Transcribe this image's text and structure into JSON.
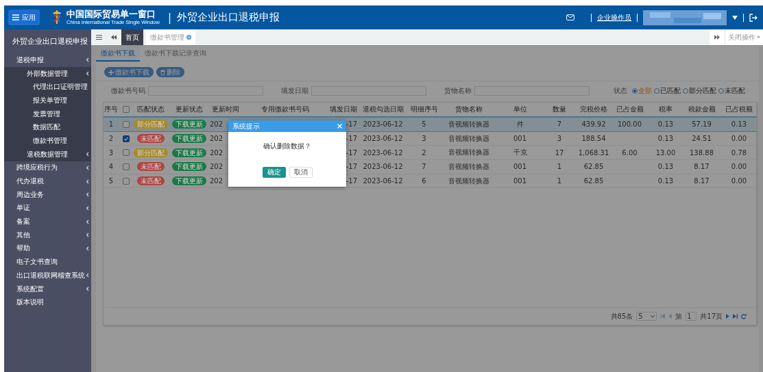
{
  "header": {
    "app_button": "应用",
    "logo_title": "中国国际贸易单一窗口",
    "logo_subtitle": "China International Trade Single Window",
    "separator": "|",
    "system_title": "外贸企业出口退税申报",
    "user_role": "企业操作员"
  },
  "sidebar": {
    "title": "外贸企业出口退税申报",
    "items": [
      {
        "label": "退税申报",
        "collapsible": true,
        "children": [
          {
            "label": "外部数据管理",
            "collapsible": true,
            "children": [
              {
                "label": "代理出口证明管理",
                "collapsible": false
              },
              {
                "label": "报关单管理",
                "collapsible": false
              },
              {
                "label": "发票管理",
                "collapsible": false
              },
              {
                "label": "数据匹配",
                "collapsible": false
              },
              {
                "label": "缴款书管理",
                "collapsible": false
              }
            ]
          },
          {
            "label": "退税数据管理",
            "collapsible": true
          }
        ]
      },
      {
        "label": "跨境应税行为",
        "collapsible": true
      },
      {
        "label": "代办退税",
        "collapsible": true
      },
      {
        "label": "周边业务",
        "collapsible": true
      },
      {
        "label": "单证",
        "collapsible": true
      },
      {
        "label": "备案",
        "collapsible": true
      },
      {
        "label": "其他",
        "collapsible": true
      },
      {
        "label": "帮助",
        "collapsible": true
      },
      {
        "label": "电子文书查询",
        "collapsible": false
      },
      {
        "label": "出口退税联网稽查系统",
        "collapsible": true
      },
      {
        "label": "系统配置",
        "collapsible": true
      },
      {
        "label": "版本说明",
        "collapsible": false
      }
    ]
  },
  "page_tabs": [
    {
      "label": "首页",
      "kind": "home"
    },
    {
      "label": "缴款书管理",
      "kind": "page"
    }
  ],
  "close_menu": "关闭操作",
  "sub_tabs": [
    {
      "label": "缴款书下载",
      "selected": true
    },
    {
      "label": "缴款书下载记录查询",
      "selected": false
    }
  ],
  "toolbar": [
    {
      "label": "缴款书下载",
      "kind": "add"
    },
    {
      "label": "删除",
      "kind": "delete"
    }
  ],
  "search_fields": [
    {
      "label": "缴款书号码"
    },
    {
      "label": "填发日期"
    },
    {
      "label": "货物名称"
    }
  ],
  "status_filter": {
    "label": "状态",
    "options": [
      {
        "label": "全部",
        "selected": true
      },
      {
        "label": "已匹配",
        "selected": false
      },
      {
        "label": "部分匹配",
        "selected": false
      },
      {
        "label": "未匹配",
        "selected": false
      }
    ]
  },
  "table": {
    "all_checked": false,
    "columns": [
      "序号",
      "",
      "匹配状态",
      "更新状态",
      "更新时间",
      "专用缴款书号码",
      "填发日期",
      "退税勾选日期",
      "明细序号",
      "货物名称",
      "单位",
      "数量",
      "完税价格",
      "已占金额",
      "税率",
      "税款金额",
      "已占税额"
    ],
    "rows": [
      {
        "selected": true,
        "checked": false,
        "no": "1",
        "match": {
          "label": "部分匹配",
          "color": "#a88a2a"
        },
        "update": {
          "label": "下载更新",
          "color": "#1a7a46"
        },
        "update_time": "202",
        "issue_date": "-17",
        "check_date": "2023-06-12",
        "detail_no": "5",
        "goods": "音视频转换器",
        "unit": "件",
        "qty": "7",
        "price": "439.92",
        "used_amount": "100.00",
        "tax_rate": "0.13",
        "tax_amount": "57.19",
        "used_tax": "0.13"
      },
      {
        "selected": false,
        "checked": true,
        "no": "2",
        "match": {
          "label": "未匹配",
          "color": "#b04444"
        },
        "update": {
          "label": "下载更新",
          "color": "#1a7a46"
        },
        "update_time": "202",
        "issue_date": "-17",
        "check_date": "2023-06-12",
        "detail_no": "3",
        "goods": "音视频转换器",
        "unit": "001",
        "qty": "3",
        "price": "188.54",
        "tax_rate": "0.13",
        "tax_amount": "24.51",
        "used_tax": "0.00"
      },
      {
        "selected": false,
        "checked": false,
        "no": "3",
        "match": {
          "label": "部分匹配",
          "color": "#a88a2a"
        },
        "update": {
          "label": "下载更新",
          "color": "#1a7a46"
        },
        "update_time": "202",
        "issue_date": "-17",
        "check_date": "2023-06-12",
        "detail_no": "2",
        "goods": "音视频转换器",
        "unit": "千克",
        "qty": "17",
        "price": "1,068.31",
        "used_amount": "6.00",
        "tax_rate": "13.00",
        "tax_amount": "138.88",
        "used_tax": "0.78"
      },
      {
        "selected": false,
        "checked": false,
        "no": "4",
        "match": {
          "label": "未匹配",
          "color": "#b04444"
        },
        "update": {
          "label": "下载更新",
          "color": "#1a7a46"
        },
        "update_time": "202",
        "issue_date": "-17",
        "check_date": "2023-06-12",
        "detail_no": "7",
        "goods": "音视频转换器",
        "unit": "001",
        "qty": "1",
        "price": "62.85",
        "tax_rate": "0.13",
        "tax_amount": "8.17",
        "used_tax": "0.00"
      },
      {
        "selected": false,
        "checked": false,
        "no": "5",
        "match": {
          "label": "未匹配",
          "color": "#b04444"
        },
        "update": {
          "label": "下载更新",
          "color": "#1a7a46"
        },
        "update_time": "202",
        "issue_date": "-17",
        "check_date": "2023-06-12",
        "detail_no": "6",
        "goods": "音视频转换器",
        "unit": "001",
        "qty": "1",
        "price": "62.85",
        "tax_rate": "0.13",
        "tax_amount": "8.17",
        "used_tax": "0.00"
      }
    ]
  },
  "pagination": {
    "total": "共85条",
    "page_size": "5",
    "page_label": "第",
    "page": "1",
    "pages": "共17页"
  },
  "dialog": {
    "title": "系统提示",
    "message": "确认删除数据？",
    "buttons": [
      {
        "label": "确定",
        "kind": "primary"
      },
      {
        "label": "取消",
        "kind": "default"
      }
    ]
  }
}
